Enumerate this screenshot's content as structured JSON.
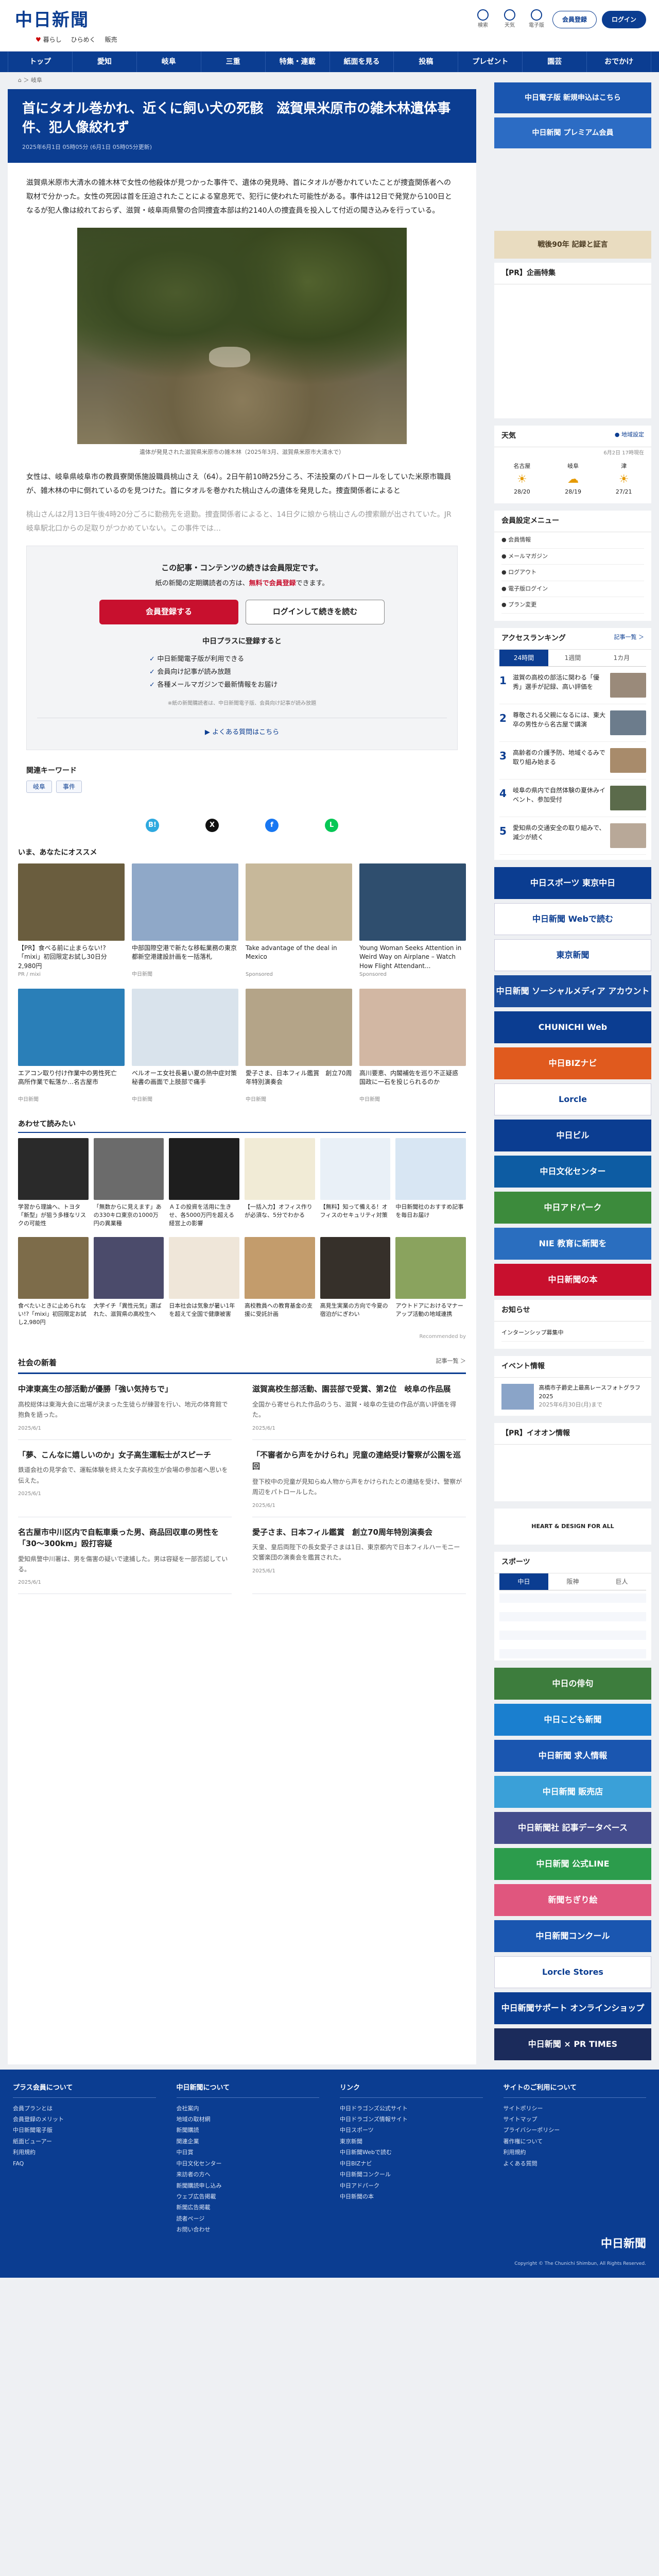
{
  "header": {
    "logo": "中日新聞",
    "sub_links": [
      "暮らし",
      "ひらめく",
      "販売"
    ],
    "utils": [
      "検索",
      "天気",
      "電子版"
    ],
    "register": "会員登録",
    "login": "ログイン"
  },
  "gnav": [
    "トップ",
    "愛知",
    "岐阜",
    "三重",
    "特集・連載",
    "紙面を見る",
    "投稿",
    "プレゼント",
    "園芸",
    "おでかけ"
  ],
  "article": {
    "breadcrumb": "⌂ ＞ 岐阜",
    "title": "首にタオル巻かれ、近くに飼い犬の死骸　滋賀県米原市の雑木林遺体事件、犯人像絞れず",
    "date": "2025年6月1日 05時05分 (6月1日 05時05分更新)",
    "p1": "滋賀県米原市大清水の雑木林で女性の他殺体が見つかった事件で、遺体の発見時、首にタオルが巻かれていたことが捜査関係者への取材で分かった。女性の死因は首を圧迫されたことによる窒息死で、犯行に使われた可能性がある。事件は12日で発覚から100日となるが犯人像は絞れておらず、滋賀・岐阜両県警の合同捜査本部は約2140人の捜査員を投入して付近の聞き込みを行っている。",
    "caption": "遺体が発見された滋賀県米原市の雑木林（2025年3月、滋賀県米原市大清水で）",
    "p2": "女性は、岐阜県岐阜市の教員寮関係施設職員桃山さえ（64）。2日午前10時25分ころ、不法投棄のパトロールをしていた米原市職員が、雑木林の中に倒れているのを見つけた。首にタオルを巻かれた桃山さんの遺体を発見した。捜査関係者によると",
    "p3": "桃山さんは2月13日午後4時20分ごろに勤務先を退勤。捜査関係者によると、14日夕に娘から桃山さんの捜索願が出されていた。JR岐阜駅北口からの足取りがつかめていない。この事件では…"
  },
  "paywall": {
    "line1": "この記事・コンテンツの続きは会員限定です。",
    "line2_pre": "紙の新聞の定期購読者の方は、",
    "line2_em": "無料で会員登録",
    "line2_post": "できます。",
    "btn_register": "会員登録する",
    "btn_login": "ログインして続きを読む",
    "plus_title": "中日プラスに登録すると",
    "benefits": [
      "中日新聞電子版が利用できる",
      "会員向け記事が読み放題",
      "各種メールマガジンで最新情報をお届け"
    ],
    "note": "※紙の新聞購読者は、中日新聞電子版、会員向け記事が読み放題",
    "faq": "よくある質問はこちら"
  },
  "keywords": {
    "title": "関連キーワード",
    "items": [
      "岐阜",
      "事件"
    ]
  },
  "shares": [
    {
      "label": "B!",
      "color": "#2ea9df"
    },
    {
      "label": "X",
      "color": "#111111"
    },
    {
      "label": "f",
      "color": "#1877f2"
    },
    {
      "label": "L",
      "color": "#06c755"
    }
  ],
  "recommend": {
    "title": "いま、あなたにオススメ",
    "items": [
      {
        "t": "【PR】食べる前に止まらない!?「mixi」初回限定お試し30日分2,980円",
        "s": "PR / mixi",
        "c": "#6a5d3e"
      },
      {
        "t": "中部国際空港で新たな移転業務の東京都新空港建設計画を一括落札",
        "s": "中日新聞",
        "c": "#8fa8c8"
      },
      {
        "t": "Take advantage of the deal in Mexico",
        "s": "Sponsored",
        "c": "#c7b89a"
      },
      {
        "t": "Young Woman Seeks Attention in Weird Way on Airplane – Watch How Flight Attendant...",
        "s": "Sponsored",
        "c": "#2f4e6e"
      },
      {
        "t": "エアコン取り付け作業中の男性死亡　高所作業で転落か…名古屋市",
        "s": "中日新聞",
        "c": "#2a7fb8"
      },
      {
        "t": "ベルオーエ女社長暑い夏の熱中症対策　秘書の画面で上肢部で痛手",
        "s": "中日新聞",
        "c": "#d9e3ec"
      },
      {
        "t": "愛子さま、日本フィル鑑賞　創立70周年特別演奏会",
        "s": "中日新聞",
        "c": "#b4a488"
      },
      {
        "t": "高川要恵、内閣補佐を巡り不正疑惑　国政に一石を投じられるのか",
        "s": "中日新聞",
        "c": "#d2b7a3"
      }
    ]
  },
  "also": {
    "title": "あわせて読みたい",
    "items": [
      {
        "t": "学習から理論へ、トヨタ「新型」が狙う多様なリスクの可能性",
        "c": "#2a2a2a"
      },
      {
        "t": "「無数からに見えます」あの330キロ東京の1000万円の異業種",
        "c": "#6b6b6b"
      },
      {
        "t": "ＡＩの投資を活用に生きせ、各5000万円を超える経営上の影響",
        "c": "#1e1e1e"
      },
      {
        "t": "【一括入力】オフィス作りが必須な、5分でわかる",
        "c": "#f1ebd6"
      },
      {
        "t": "【無料】知って備える！オフィスのセキュリティ対策",
        "c": "#e9f0f7"
      },
      {
        "t": "中日新聞社のおすすめ記事を毎日お届け",
        "c": "#d8e6f3"
      },
      {
        "t": "食べたいときに止められない!?「mixi」初回限定お試し2,980円",
        "c": "#7d6c4a"
      },
      {
        "t": "大学イチ「異性元気」選ばれた、滋賀県の高校生へ",
        "c": "#4b4b6b"
      },
      {
        "t": "日本社会は気象が暑い1年を超えて全国で健康被害",
        "c": "#efe6d9"
      },
      {
        "t": "高校教員への教育基金の支援に受託計画",
        "c": "#c39c6c"
      },
      {
        "t": "高見生実業の方向で今夏の宿泊がにぎわい",
        "c": "#36302a"
      },
      {
        "t": "アウトドアにおけるマナーアップ活動の地域連携",
        "c": "#8aa35e"
      }
    ],
    "footer": "Recommended by"
  },
  "social": {
    "title": "社会の新着",
    "more": "記事一覧 ＞",
    "items": [
      {
        "t": "中津東高生の部活動が優勝「強い気持ちで」",
        "d": "高校総体は東海大会に出場が決まった生徒らが練習を行い、地元の体育館で抱負を語った。",
        "m": "2025/6/1"
      },
      {
        "t": "滋賀高校生部活動、園芸部で受賞、第2位　岐阜の作品展",
        "d": "全国から寄せられた作品のうち、滋賀・岐阜の生徒の作品が高い評価を得た。",
        "m": "2025/6/1"
      },
      {
        "t": "「夢、こんなに嬉しいのか」女子高生運転士がスピーチ",
        "d": "鉄道会社の見学会で、運転体験を終えた女子高校生が会場の参加者へ思いを伝えた。",
        "m": "2025/6/1"
      },
      {
        "t": "「不審者から声をかけられ」児童の連絡受け警察が公園を巡回",
        "d": "登下校中の児童が見知らぬ人物から声をかけられたとの連絡を受け、警察が周辺をパトロールした。",
        "m": "2025/6/1"
      },
      {
        "t": "名古屋市中川区内で自転車乗った男、商品回収車の男性を「30～300km」殴打容疑",
        "d": "愛知県警中川署は、男を傷害の疑いで逮捕した。男は容疑を一部否認している。",
        "m": "2025/6/1"
      },
      {
        "t": "愛子さま、日本フィル鑑賞　創立70周年特別演奏会",
        "d": "天皇、皇后両陛下の長女愛子さまは1日、東京都内で日本フィルハーモニー交響楽団の演奏会を鑑賞された。",
        "m": "2025/6/1"
      }
    ]
  },
  "side": {
    "banners": [
      {
        "t": "中日電子版 新規申込はこちら",
        "c": "#1a56b0"
      },
      {
        "t": "中日新聞 プレミアム会員",
        "c": "#2c6cc4"
      }
    ],
    "banner_beige": "戦後90年 記録と証言",
    "pr_title": "【PR】企画特集",
    "weather": {
      "title": "天気",
      "more": "● 地域設定",
      "date": "6月2日 17時現在",
      "cities": [
        {
          "n": "名古屋",
          "i": "☀",
          "t": "28/20"
        },
        {
          "n": "岐阜",
          "i": "☁",
          "t": "28/19"
        },
        {
          "n": "津",
          "i": "☀",
          "t": "27/21"
        }
      ]
    },
    "member": {
      "title": "会員設定メニュー",
      "items": [
        "会員情報",
        "メールマガジン",
        "ログアウト",
        "電子版ログイン",
        "プラン変更"
      ]
    },
    "ranking": {
      "title": "アクセスランキング",
      "more": "記事一覧 ＞",
      "tabs": [
        "24時間",
        "1週間",
        "1カ月"
      ],
      "items": [
        {
          "t": "滋賀の高校の部活に関わる「優秀」選手が記録、高い評価を",
          "c": "#9a8a7a"
        },
        {
          "t": "尊敬される父親になるには、東大卒の男性から名古屋で講演",
          "c": "#6c7c8c"
        },
        {
          "t": "高齢者の介護予防、地域ぐるみで取り組み始まる",
          "c": "#a88b6b"
        },
        {
          "t": "岐阜の県内で自然体験の夏休みイベント、参加受付",
          "c": "#5b6b4b"
        },
        {
          "t": "愛知県の交通安全の取り組みで、減少が続く",
          "c": "#b8a898"
        }
      ]
    },
    "ads": [
      {
        "t": "中日スポーツ 東京中日",
        "c": "#0b3d91"
      },
      {
        "t": "中日新聞 Webで読む",
        "c": "#ffffff"
      },
      {
        "t": "東京新聞",
        "c": "#ffffff"
      },
      {
        "t": "中日新聞 ソーシャルメディア アカウント",
        "c": "#1a4c9c"
      },
      {
        "t": "CHUNICHI Web",
        "c": "#0b3d91"
      },
      {
        "t": "中日BIZナビ",
        "c": "#e05a1e"
      },
      {
        "t": "Lorcle",
        "c": "#ffffff"
      },
      {
        "t": "中日ビル",
        "c": "#0b3d91"
      },
      {
        "t": "中日文化センター",
        "c": "#0d5ca3"
      },
      {
        "t": "中日アドパーク",
        "c": "#3c8b3c"
      },
      {
        "t": "NIE 教育に新聞を",
        "c": "#2a6ebf"
      },
      {
        "t": "中日新聞の本",
        "c": "#c8102e"
      }
    ],
    "notice_title": "お知らせ",
    "notice": [
      "インターンシップ募集中"
    ],
    "events_title": "イベント情報",
    "event": "高橋市子爵史上最高レースフォトグラフ 2025",
    "event_date": "2025年6月30日(月)まで",
    "pr_events": "【PR】イオオン情報",
    "heart": "HEART & DESIGN FOR ALL",
    "sports": "スポーツ",
    "game_tabs": [
      "中日",
      "阪神",
      "巨人"
    ],
    "ad2": [
      {
        "t": "中日の俳句",
        "c": "#3d7d3d"
      },
      {
        "t": "中日こども新聞",
        "c": "#1a7fcf"
      },
      {
        "t": "中日新聞 求人情報",
        "c": "#1a56b0"
      },
      {
        "t": "中日新聞 販売店",
        "c": "#3aa0d8"
      },
      {
        "t": "中日新聞社 記事データベース",
        "c": "#444c8c"
      },
      {
        "t": "中日新聞 公式LINE",
        "c": "#2c9c4c"
      },
      {
        "t": "新聞ちぎり絵",
        "c": "#e0567e"
      },
      {
        "t": "中日新聞コンクール",
        "c": "#1a56b0"
      },
      {
        "t": "Lorcle Stores",
        "c": "#ffffff"
      },
      {
        "t": "中日新聞サポート オンラインショップ",
        "c": "#0b3d91"
      },
      {
        "t": "中日新聞 × PR TIMES",
        "c": "#1b2b5b"
      }
    ]
  },
  "footer": {
    "cols": [
      {
        "h": "プラス会員について",
        "items": [
          "会員プランとは",
          "会員登録のメリット",
          "中日新聞電子版",
          "紙面ビューアー",
          "利用規約",
          "FAQ"
        ]
      },
      {
        "h": "中日新聞について",
        "items": [
          "会社案内",
          "地域の取材網",
          "新聞購読",
          "関連企業",
          "中日賞",
          "中日文化センター",
          "来訪者の方へ",
          "新聞購読申し込み",
          "ウェブ広告掲載",
          "新聞広告掲載",
          "読者ページ",
          "お問い合わせ"
        ]
      },
      {
        "h": "リンク",
        "items": [
          "中日ドラゴンズ公式サイト",
          "中日ドラゴンズ情報サイト",
          "中日スポーツ",
          "東京新聞",
          "中日新聞Webで読む",
          "中日BIZナビ",
          "中日新聞コンクール",
          "中日アドパーク",
          "中日新聞の本"
        ]
      },
      {
        "h": "サイトのご利用について",
        "items": [
          "サイトポリシー",
          "サイトマップ",
          "プライバシーポリシー",
          "著作権について",
          "利用規約",
          "よくある質問"
        ]
      }
    ],
    "logo": "中日新聞",
    "copy": "Copyright © The Chunichi Shimbun, All Rights Reserved."
  }
}
